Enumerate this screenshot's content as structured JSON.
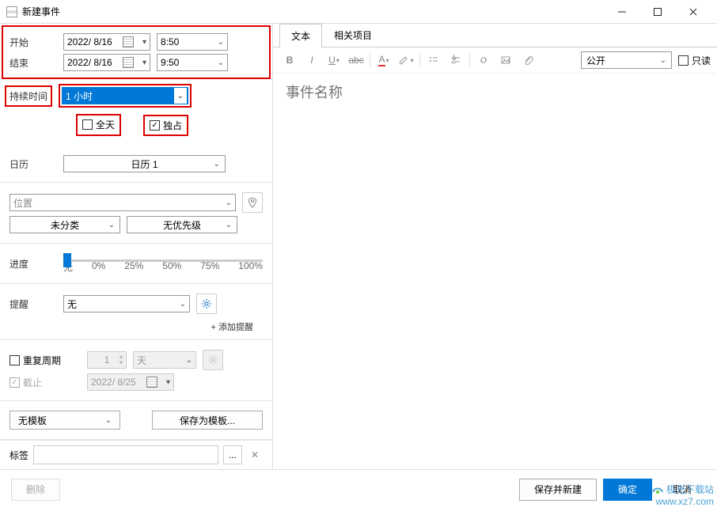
{
  "window": {
    "title": "新建事件"
  },
  "left": {
    "start_label": "开始",
    "end_label": "结束",
    "start_date": "2022/ 8/16",
    "end_date": "2022/ 8/16",
    "start_time": "8:50",
    "end_time": "9:50",
    "duration_label": "持续时间",
    "duration_value": "1 小时",
    "allday_label": "全天",
    "exclusive_label": "独占",
    "calendar_label": "日历",
    "calendar_value": "日历 1",
    "location_placeholder": "位置",
    "category_value": "未分类",
    "priority_value": "无优先级",
    "progress_label": "进度",
    "progress_ticks": [
      "无",
      "0%",
      "25%",
      "50%",
      "75%",
      "100%"
    ],
    "reminder_label": "提醒",
    "reminder_value": "无",
    "add_reminder": "+ 添加提醒",
    "repeat_label": "重复周期",
    "repeat_count": "1",
    "repeat_unit": "天",
    "deadline_label": "截止",
    "deadline_date": "2022/ 8/25",
    "template_value": "无模板",
    "save_template": "保存为模板...",
    "tag_label": "标签",
    "tag_more": "..."
  },
  "right": {
    "tabs": {
      "text": "文本",
      "related": "相关项目"
    },
    "visibility": "公开",
    "readonly_label": "只读",
    "title_placeholder": "事件名称"
  },
  "footer": {
    "delete": "删除",
    "save_new": "保存并新建",
    "ok": "确定",
    "cancel": "取消"
  },
  "watermark": {
    "brand": "极光下载站",
    "url": "www.xz7.com"
  }
}
